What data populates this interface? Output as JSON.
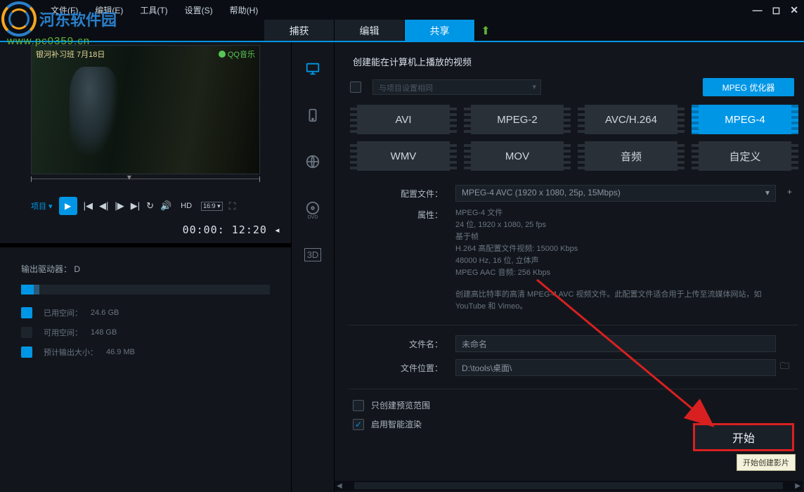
{
  "watermark": {
    "brand": "河东软件园",
    "url": "www.pc0359.cn"
  },
  "menu": {
    "file": "文件(F)",
    "edit": "编辑(E)",
    "tools": "工具(T)",
    "settings": "设置(S)",
    "help": "帮助(H)"
  },
  "tabs": {
    "capture": "捕获",
    "edit": "编辑",
    "share": "共享"
  },
  "preview": {
    "overlay_tl": "银河补习班  7月18日",
    "overlay_tr": "QQ音乐",
    "project_label": "项目 ▾",
    "hd": "HD",
    "ratio": "16:9 ▾",
    "timecode": "00:00:  12:20 ◂"
  },
  "cut": {
    "scissors": "✂",
    "link": "⊘"
  },
  "drives": {
    "title_label": "输出驱动器：",
    "title_value": "D",
    "used_label": "已用空间：",
    "used_value": "24.6 GB",
    "free_label": "可用空间：",
    "free_value": "148 GB",
    "est_label": "预计输出大小：",
    "est_value": "46.9 MB"
  },
  "share": {
    "heading": "创建能在计算机上播放的视频",
    "same_as_project": "与项目设置相同",
    "optimizer": "MPEG 优化器",
    "formats": [
      "AVI",
      "MPEG-2",
      "AVC/H.264",
      "MPEG-4",
      "WMV",
      "MOV",
      "音频",
      "自定义"
    ],
    "selected_format_index": 3,
    "profile_label": "配置文件：",
    "profile_value": "MPEG-4 AVC (1920 x 1080, 25p, 15Mbps)",
    "attr_label": "属性：",
    "attrs": {
      "l1": "MPEG-4 文件",
      "l2": "24 位, 1920 x 1080, 25 fps",
      "l3": "基于帧",
      "l4": "H.264 高配置文件视频: 15000 Kbps",
      "l5": "48000 Hz, 16 位, 立体声",
      "l6": "MPEG AAC 音频: 256 Kbps"
    },
    "desc": "创建高比特率的高清 MPEG-4 AVC 视频文件。此配置文件适合用于上传至流媒体网站，如 YouTube 和 Vimeo。",
    "filename_label": "文件名：",
    "filename_value": "未命名",
    "filepath_label": "文件位置：",
    "filepath_value": "D:\\tools\\桌面\\",
    "opt_preview_only": "只创建预览范围",
    "opt_smart_render": "启用智能渲染",
    "start": "开始",
    "tooltip": "开始创建影片"
  }
}
